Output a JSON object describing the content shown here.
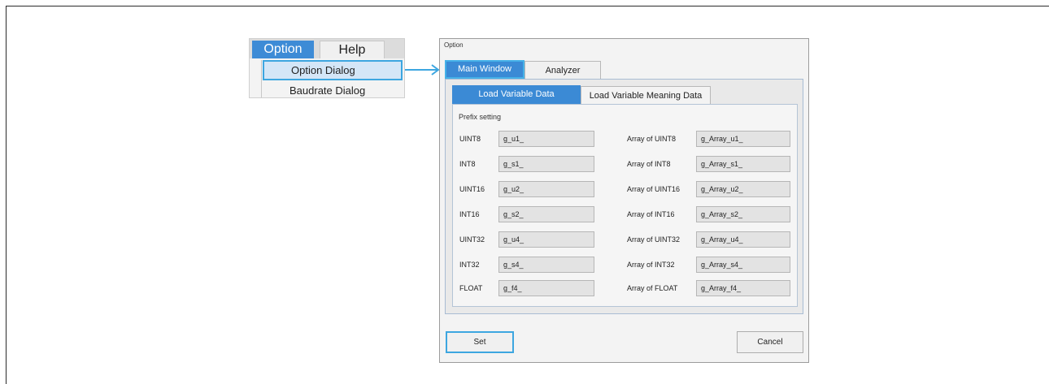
{
  "menu": {
    "tabs": [
      {
        "label": "Option"
      },
      {
        "label": "Help"
      }
    ],
    "items": [
      {
        "label": "Option Dialog"
      },
      {
        "label": "Baudrate Dialog"
      }
    ]
  },
  "dialog": {
    "title": "Option",
    "tabs": [
      {
        "label": "Main Window"
      },
      {
        "label": "Analyzer"
      }
    ],
    "subtabs": [
      {
        "label": "Load Variable Data"
      },
      {
        "label": "Load Variable Meaning Data"
      }
    ],
    "section_label": "Prefix setting",
    "rows": [
      {
        "type": "UINT8",
        "value": "g_u1_",
        "array_type": "Array of UINT8",
        "array_value": "g_Array_u1_"
      },
      {
        "type": "INT8",
        "value": "g_s1_",
        "array_type": "Array of INT8",
        "array_value": "g_Array_s1_"
      },
      {
        "type": "UINT16",
        "value": "g_u2_",
        "array_type": "Array of UINT16",
        "array_value": "g_Array_u2_"
      },
      {
        "type": "INT16",
        "value": "g_s2_",
        "array_type": "Array of INT16",
        "array_value": "g_Array_s2_"
      },
      {
        "type": "UINT32",
        "value": "g_u4_",
        "array_type": "Array of UINT32",
        "array_value": "g_Array_u4_"
      },
      {
        "type": "INT32",
        "value": "g_s4_",
        "array_type": "Array of INT32",
        "array_value": "g_Array_s4_"
      },
      {
        "type": "FLOAT",
        "value": "g_f4_",
        "array_type": "Array of FLOAT",
        "array_value": "g_Array_f4_"
      }
    ],
    "buttons": {
      "set": "Set",
      "cancel": "Cancel"
    }
  },
  "colors": {
    "accent": "#3b8ad5",
    "highlight_border": "#3da6e0"
  }
}
